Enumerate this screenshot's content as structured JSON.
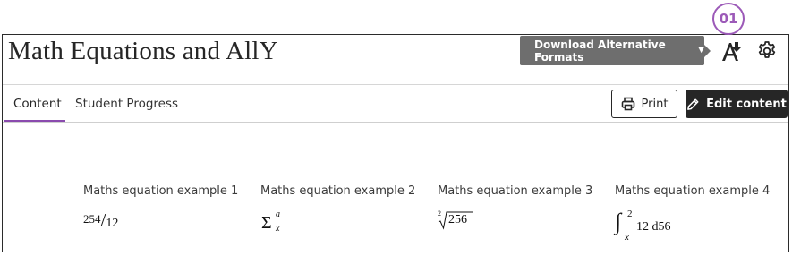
{
  "step_badge": "01",
  "page": {
    "title": "Math Equations and AllY"
  },
  "toolbar": {
    "tooltip": "Download Alternative Formats",
    "ally_icon": "ally-alternative-formats-icon",
    "settings_icon": "gear-icon"
  },
  "tabs": [
    {
      "label": "Content",
      "active": true
    },
    {
      "label": "Student Progress",
      "active": false
    }
  ],
  "actions": {
    "print_label": "Print",
    "edit_label": "Edit content"
  },
  "equations": [
    {
      "label": "Maths equation example 1",
      "numerator": "254",
      "slash": "/",
      "denominator": "12"
    },
    {
      "label": "Maths equation example 2",
      "operator": "Σ",
      "upper": "a",
      "lower": "x"
    },
    {
      "label": "Maths equation example 3",
      "index": "2",
      "radicand": "256"
    },
    {
      "label": "Maths equation example 4",
      "operator": "∫",
      "upper": "2",
      "lower": "x",
      "body": "12 d56"
    }
  ],
  "colors": {
    "accent": "#8a4bae",
    "badge": "#9c5ab8",
    "tooltip_bg": "#6e6e6e",
    "primary_button": "#262626"
  }
}
